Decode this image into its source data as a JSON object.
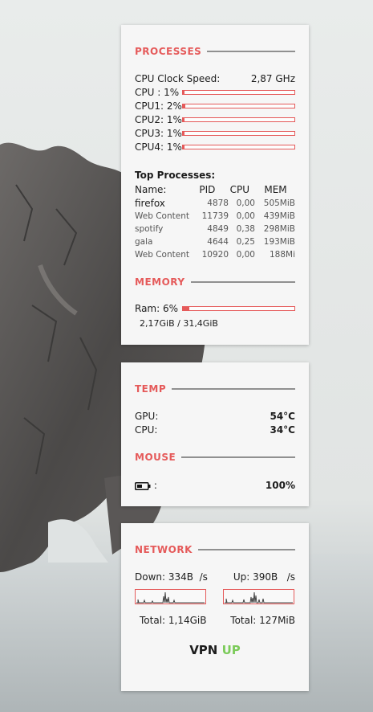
{
  "processes": {
    "title": "PROCESSES",
    "clock_label": "CPU Clock Speed:",
    "clock_value": "2,87 GHz",
    "cpus": [
      {
        "label": "CPU : 1%",
        "usage_percent": 1
      },
      {
        "label": "CPU1: 2%",
        "usage_percent": 2
      },
      {
        "label": "CPU2: 1%",
        "usage_percent": 1
      },
      {
        "label": "CPU3: 1%",
        "usage_percent": 1
      },
      {
        "label": "CPU4: 1%",
        "usage_percent": 1
      }
    ],
    "top_title": "Top Processes:",
    "headers": {
      "name": "Name:",
      "pid": "PID",
      "cpu": "CPU",
      "mem": "MEM"
    },
    "rows": [
      {
        "name": "firefox",
        "pid": "4878",
        "cpu": "0,00",
        "mem": "505MiB"
      },
      {
        "name": "Web Content",
        "pid": "11739",
        "cpu": "0,00",
        "mem": "439MiB"
      },
      {
        "name": "spotify",
        "pid": "4849",
        "cpu": "0,38",
        "mem": "298MiB"
      },
      {
        "name": "gala",
        "pid": "4644",
        "cpu": "0,25",
        "mem": "193MiB"
      },
      {
        "name": "Web Content",
        "pid": "10920",
        "cpu": "0,00",
        "mem": "188Mi"
      }
    ]
  },
  "memory": {
    "title": "MEMORY",
    "ram_label": "Ram: 6%",
    "ram_percent": 6,
    "ram_detail": "2,17GiB / 31,4GiB"
  },
  "temp": {
    "title": "TEMP",
    "gpu_label": "GPU:",
    "gpu_value": "54°C",
    "cpu_label": "CPU:",
    "cpu_value": "34°C"
  },
  "mouse": {
    "title": "MOUSE",
    "battery_icon": "battery-icon",
    "colon": ":",
    "battery_value": "100%"
  },
  "network": {
    "title": "NETWORK",
    "down_label": "Down: 334B  /s",
    "up_label": "Up: 390B   /s",
    "down_total": "Total: 1,14GiB",
    "up_total": "Total: 127MiB",
    "vpn_label": "VPN",
    "vpn_status": "UP"
  },
  "colors": {
    "accent": "#e55a5a",
    "vpn_up": "#7ccb5a",
    "panel_bg": "#f6f6f6"
  }
}
